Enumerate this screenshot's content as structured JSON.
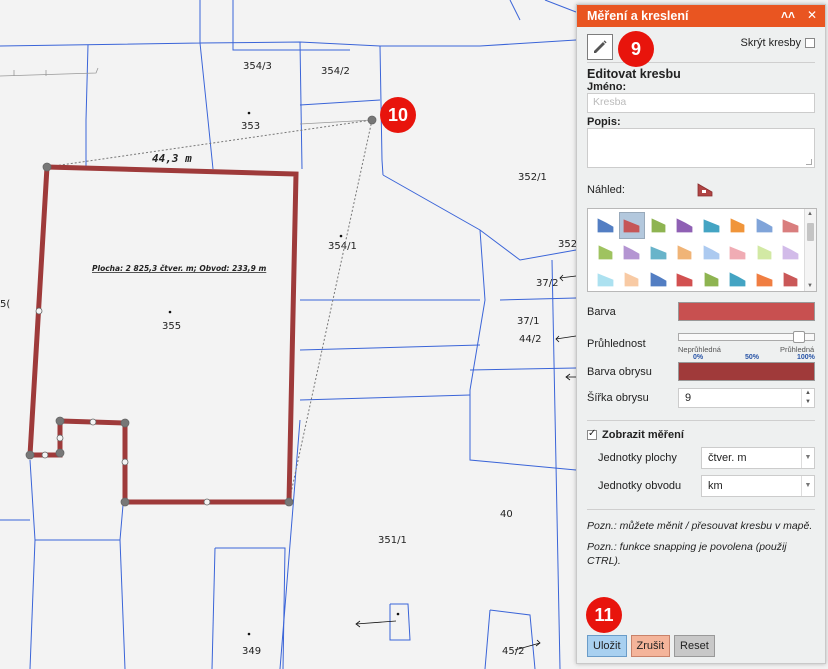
{
  "map": {
    "parcels": [
      "354/3",
      "354/2",
      "353",
      "352/1",
      "354/1",
      "352/",
      "37/2",
      "37/1",
      "44/2",
      "355",
      "5(",
      "40",
      "351/1",
      "349",
      "45/2"
    ],
    "measure_distance": "44,3 m",
    "area_label": "Plocha: 2 825,3 čtver. m; Obvod: 233,9 m",
    "polygon_color": "#9e3a3a",
    "parcel_line_color": "#3a64d8"
  },
  "badges": {
    "b9": "9",
    "b10": "10",
    "b11": "11"
  },
  "panel": {
    "title": "Měření a kreslení",
    "collapse_icon": "double-chevron-up",
    "close_icon": "close",
    "hide_drawings_label": "Skrýt kresby",
    "section_title": "Editovat kresbu",
    "name_label": "Jméno:",
    "name_placeholder": "Kresba",
    "desc_label": "Popis:",
    "preview_label": "Náhled:",
    "fill_label": "Barva",
    "fill_color": "#c85050",
    "opacity_label": "Průhlednost",
    "opacity_min_label": "Neprůhledná",
    "opacity_max_label": "Průhledná",
    "opacity_ticks": [
      "0%",
      "50%",
      "100%"
    ],
    "opacity_value": 0.93,
    "outline_color_label": "Barva obrysu",
    "outline_color": "#a03a3a",
    "outline_width_label": "Šířka obrysu",
    "outline_width": "9",
    "show_measure_label": "Zobrazit měření",
    "area_units_label": "Jednotky plochy",
    "area_units_value": "čtver. m",
    "perimeter_units_label": "Jednotky obvodu",
    "perimeter_units_value": "km",
    "note1": "Pozn.: můžete měnit / přesouvat kresbu v mapě.",
    "note2": "Pozn.: funkce snapping je povolena (použij CTRL).",
    "save_label": "Uložit",
    "cancel_label": "Zrušit",
    "reset_label": "Reset"
  },
  "palette_colors": [
    "#4a78c0",
    "#c85050",
    "#88b048",
    "#8a58b0",
    "#3aa0c0",
    "#f09030",
    "#7aa0d8",
    "#d87878",
    "#9ac058",
    "#b090d0",
    "#60b0c8",
    "#f0b070",
    "#a8c8f0",
    "#f0a8b0",
    "#d0e8a0",
    "#d0b8e8",
    "#a8e0f0",
    "#f8c8a0",
    "#4a78c0",
    "#d04848",
    "#88b048",
    "#3aa0c0",
    "#f07838",
    "#c85050"
  ]
}
